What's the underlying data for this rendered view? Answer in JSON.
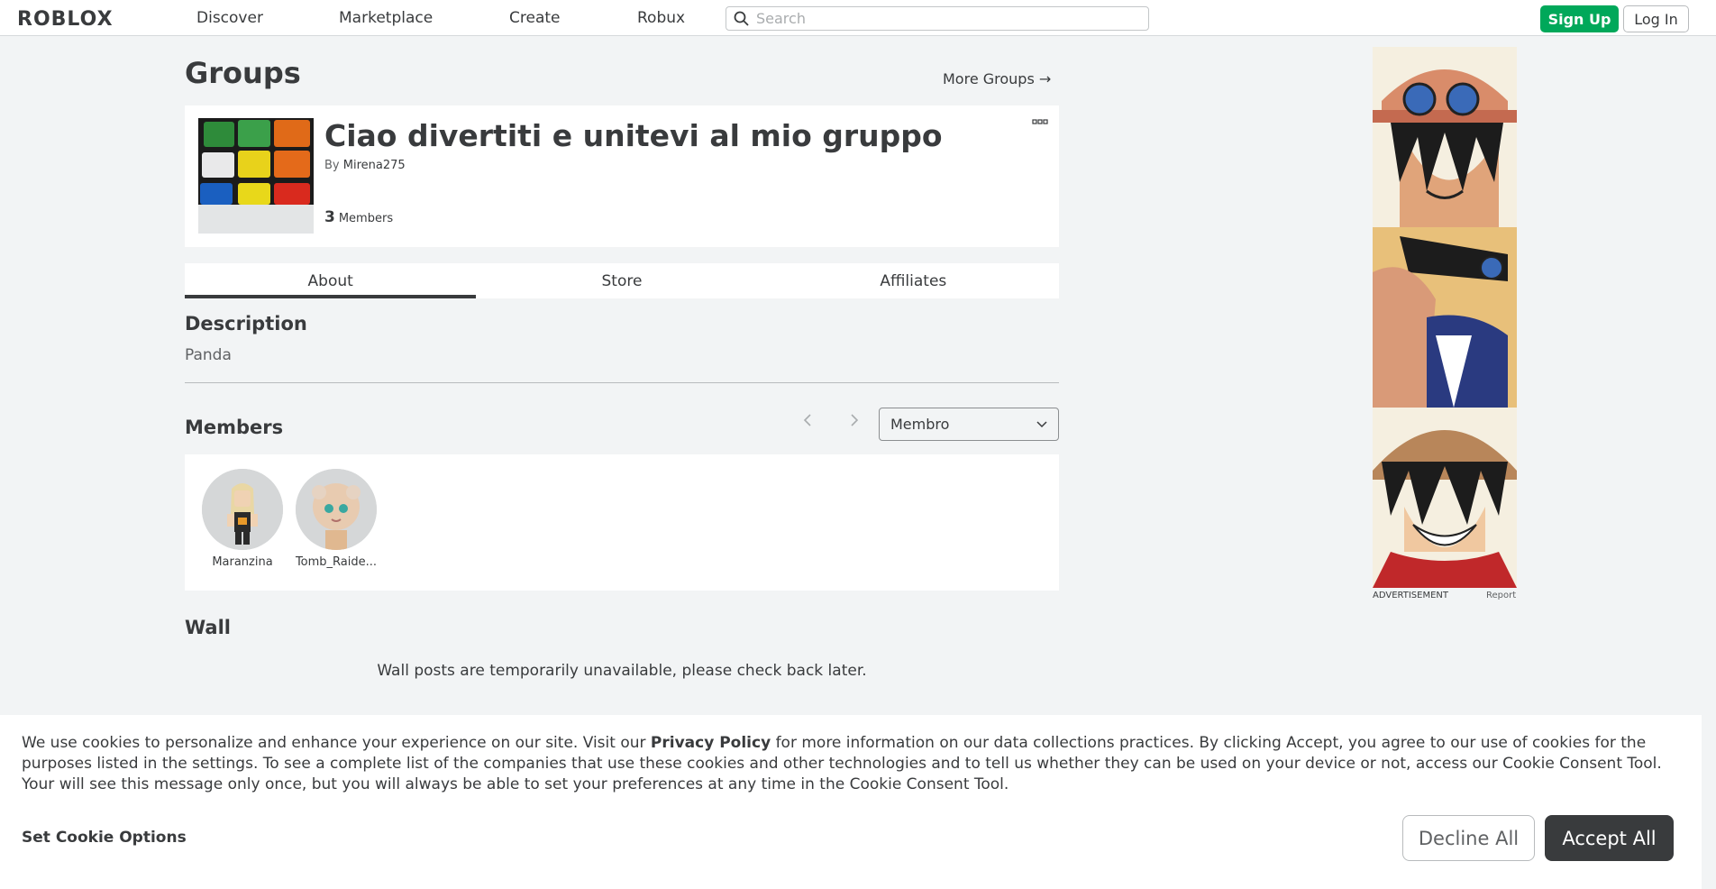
{
  "nav": {
    "logo": "ROBLOX",
    "links": [
      "Discover",
      "Marketplace",
      "Create",
      "Robux"
    ],
    "search_placeholder": "Search",
    "signup_label": "Sign Up",
    "login_label": "Log In"
  },
  "page": {
    "title": "Groups",
    "more_groups": "More Groups →"
  },
  "group": {
    "name": "Ciao divertiti e unitevi al mio gruppo",
    "by_prefix": "By",
    "owner": "Mirena275",
    "member_count": "3",
    "members_label": "Members"
  },
  "tabs": [
    "About",
    "Store",
    "Affiliates"
  ],
  "description": {
    "heading": "Description",
    "text": "Panda"
  },
  "members": {
    "heading": "Members",
    "role_selected": "Membro",
    "list": [
      {
        "name": "Maranzina"
      },
      {
        "name": "Tomb_Raide..."
      }
    ]
  },
  "wall": {
    "heading": "Wall",
    "message": "Wall posts are temporarily unavailable, please check back later."
  },
  "ad": {
    "label": "ADVERTISEMENT",
    "report": "Report"
  },
  "cookie": {
    "text_before": "We use cookies to personalize and enhance your experience on our site. Visit our ",
    "privacy_link": "Privacy Policy",
    "text_after": " for more information on our data collections practices. By clicking Accept, you agree to our use of cookies for the purposes listed in the settings. To see a complete list of the companies that use these cookies and other technologies and to tell us whether they can be used on your device or not, access our Cookie Consent Tool. Your will see this message only once, but you will always be able to set your preferences at any time in the Cookie Consent Tool.",
    "options_label": "Set Cookie Options",
    "decline_label": "Decline All",
    "accept_label": "Accept All"
  },
  "colors": {
    "signup_green": "#00a85a",
    "text_dark": "#393b3d",
    "background": "#f2f4f5"
  }
}
